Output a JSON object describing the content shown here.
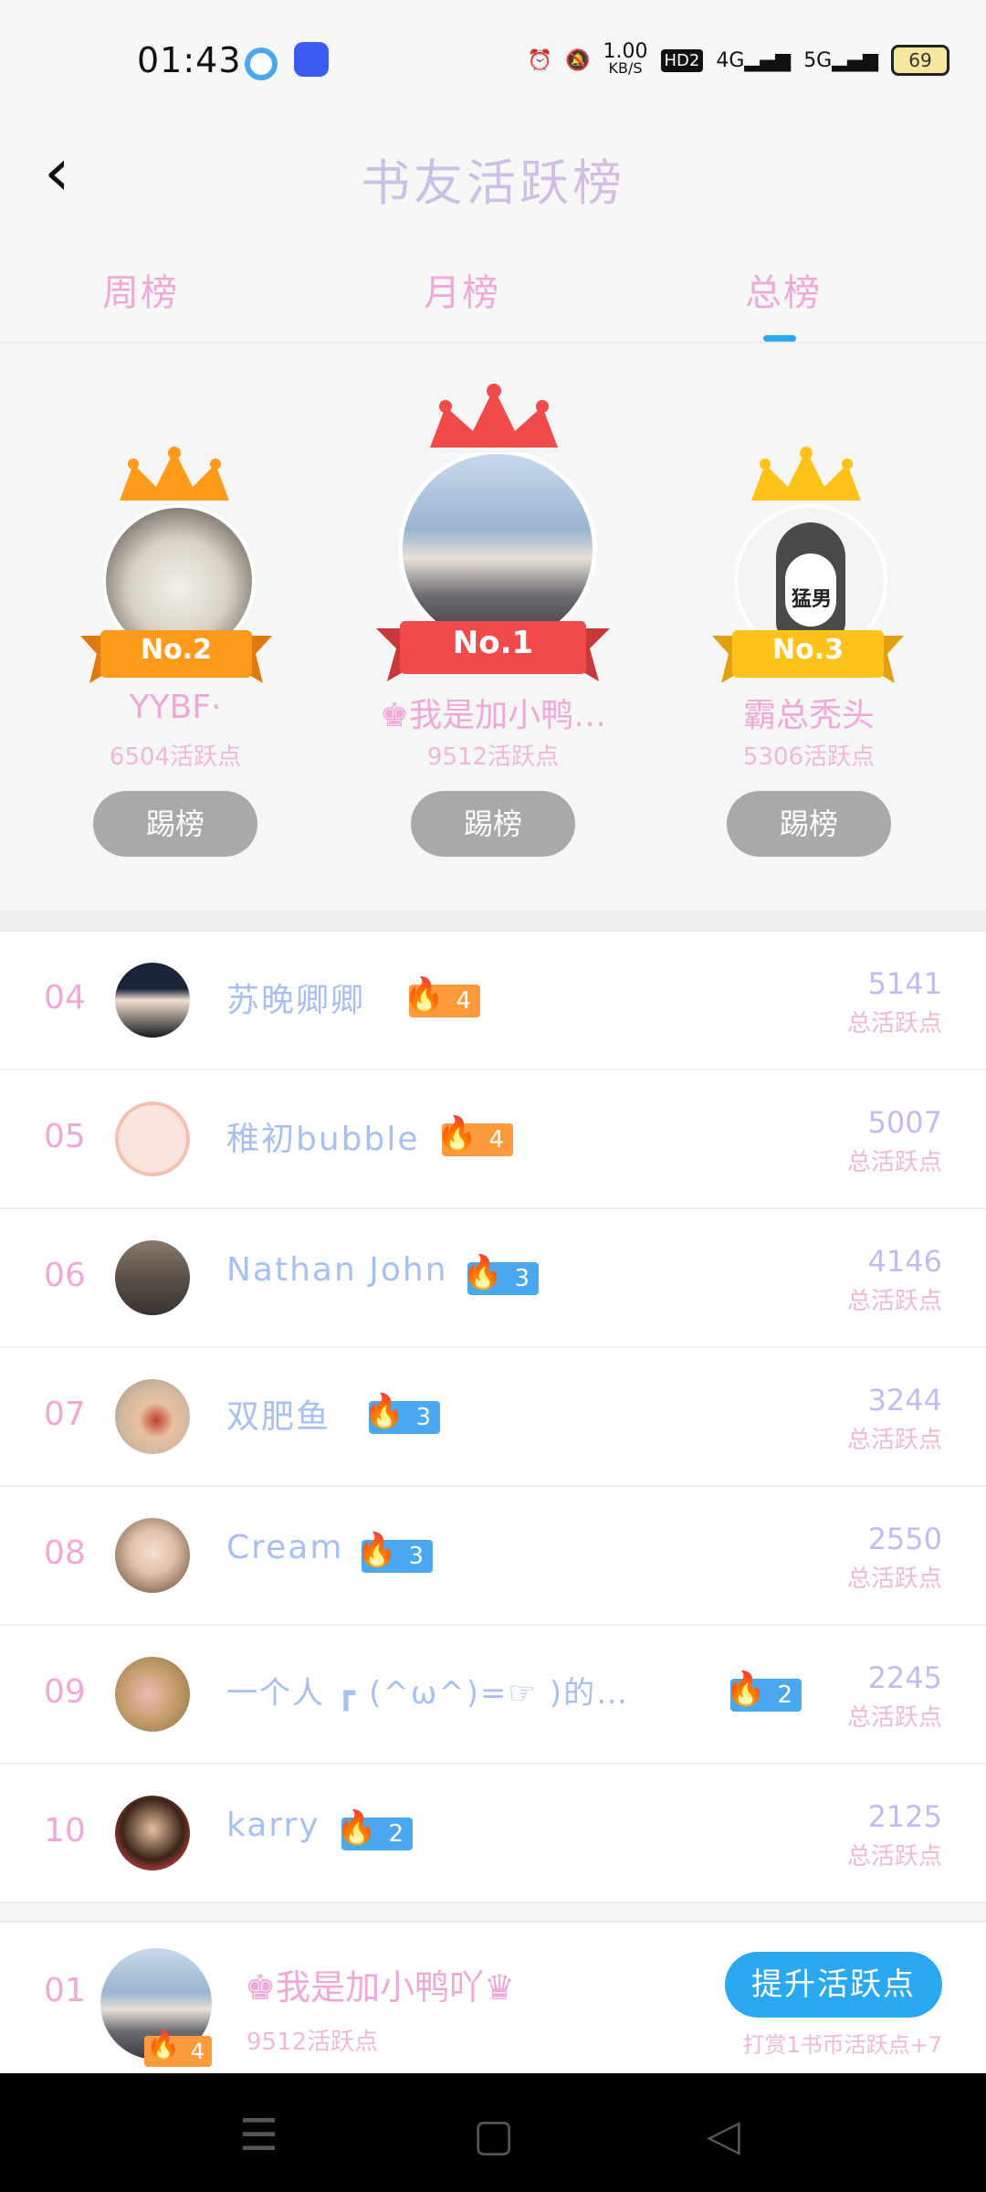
{
  "status": {
    "time": "01:43",
    "net_speed": "1.00",
    "net_unit": "KB/S",
    "hd": "HD2",
    "sig1": "4G",
    "sig2": "5G",
    "battery": "69"
  },
  "header": {
    "title": "书友活跃榜"
  },
  "tabs": [
    {
      "label": "周榜",
      "active": false
    },
    {
      "label": "月榜",
      "active": false
    },
    {
      "label": "总榜",
      "active": true
    }
  ],
  "podium": {
    "second": {
      "badge": "No.2",
      "name": "YYBF·",
      "points": "6504活跃点",
      "button": "踢榜"
    },
    "first": {
      "badge": "No.1",
      "name": "♚我是加小鸭…",
      "points": "9512活跃点",
      "button": "踢榜"
    },
    "third": {
      "badge": "No.3",
      "name": "霸总秃头",
      "points": "5306活跃点",
      "button": "踢榜",
      "avatar_text": "猛男"
    }
  },
  "ranking": [
    {
      "rank": "04",
      "name": "苏晚卿卿",
      "level": "4",
      "flame": "orange",
      "points": "5141",
      "points_label": "总活跃点"
    },
    {
      "rank": "05",
      "name": "稚初bubble",
      "level": "4",
      "flame": "orange",
      "points": "5007",
      "points_label": "总活跃点"
    },
    {
      "rank": "06",
      "name": "Nathan John",
      "level": "3",
      "flame": "blue",
      "points": "4146",
      "points_label": "总活跃点"
    },
    {
      "rank": "07",
      "name": "双肥鱼",
      "level": "3",
      "flame": "blue",
      "points": "3244",
      "points_label": "总活跃点"
    },
    {
      "rank": "08",
      "name": "Cream",
      "level": "3",
      "flame": "blue",
      "points": "2550",
      "points_label": "总活跃点"
    },
    {
      "rank": "09",
      "name": "一个人 ┏ (^ω^)=☞ )的…",
      "level": "2",
      "flame": "blue",
      "points": "2245",
      "points_label": "总活跃点"
    },
    {
      "rank": "10",
      "name": "karry",
      "level": "2",
      "flame": "blue",
      "points": "2125",
      "points_label": "总活跃点"
    }
  ],
  "mine": {
    "rank": "01",
    "name": "♚我是加小鸭吖♛",
    "level": "4",
    "points": "9512活跃点",
    "button": "提升活跃点",
    "hint": "打赏1书币活跃点+7"
  },
  "colors": {
    "accent": "#2aa8f0",
    "pink": "#f0a8d8",
    "orange_flame": "#ff9a3c",
    "blue_flame": "#4aa8f0"
  }
}
